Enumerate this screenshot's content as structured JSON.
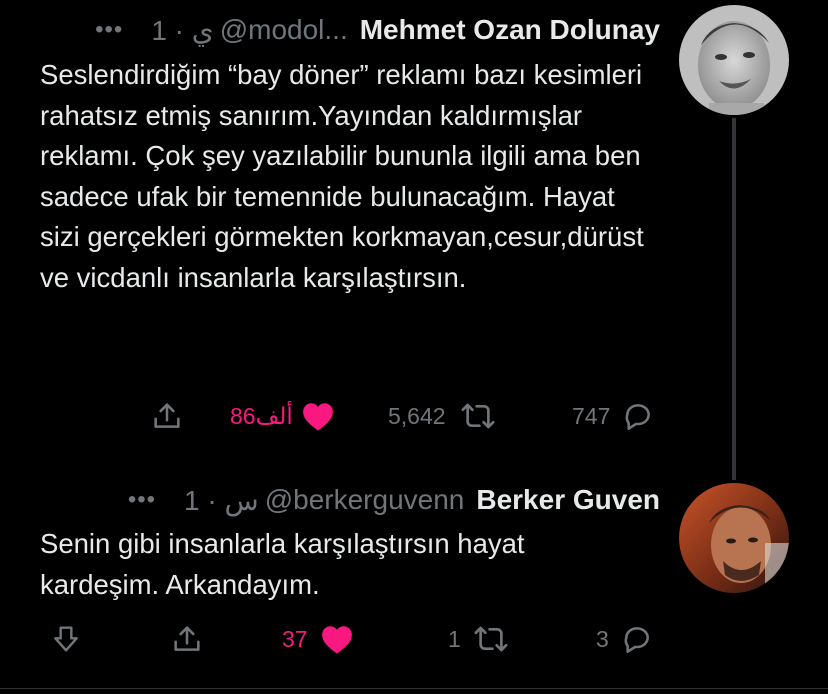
{
  "tweets": [
    {
      "more": "•••",
      "time": "1 · ي",
      "handle": "@modol...",
      "name": "Mehmet Ozan Dolunay",
      "text": "Seslendirdiğim “bay döner” reklamı bazı kesimleri rahatsız etmiş sanırım.Yayından kaldırmışlar reklamı. Çok şey yazılabilir bununla ilgili ama ben sadece ufak bir temennide bulunacağım. Hayat sizi gerçekleri görmekten korkmayan,cesur,dürüst ve vicdanlı insanlarla karşılaştırsın.",
      "likes": "86ألف",
      "retweets": "5,642",
      "replies": "747"
    },
    {
      "more": "•••",
      "time": "1 · س",
      "handle": "@berkerguvenn",
      "name": "Berker Guven",
      "text": "Senin gibi insanlarla karşılaştırsın hayat kardeşim. Arkandayım.",
      "likes": "37",
      "retweets": "1",
      "replies": "3"
    }
  ],
  "colors": {
    "background": "#000000",
    "text": "#e7e9ea",
    "muted": "#71767b",
    "like": "#f91880",
    "thread": "#333639"
  },
  "icons": [
    "more-icon",
    "share-icon",
    "heart-icon",
    "retweet-icon",
    "reply-icon",
    "downvote-icon"
  ]
}
